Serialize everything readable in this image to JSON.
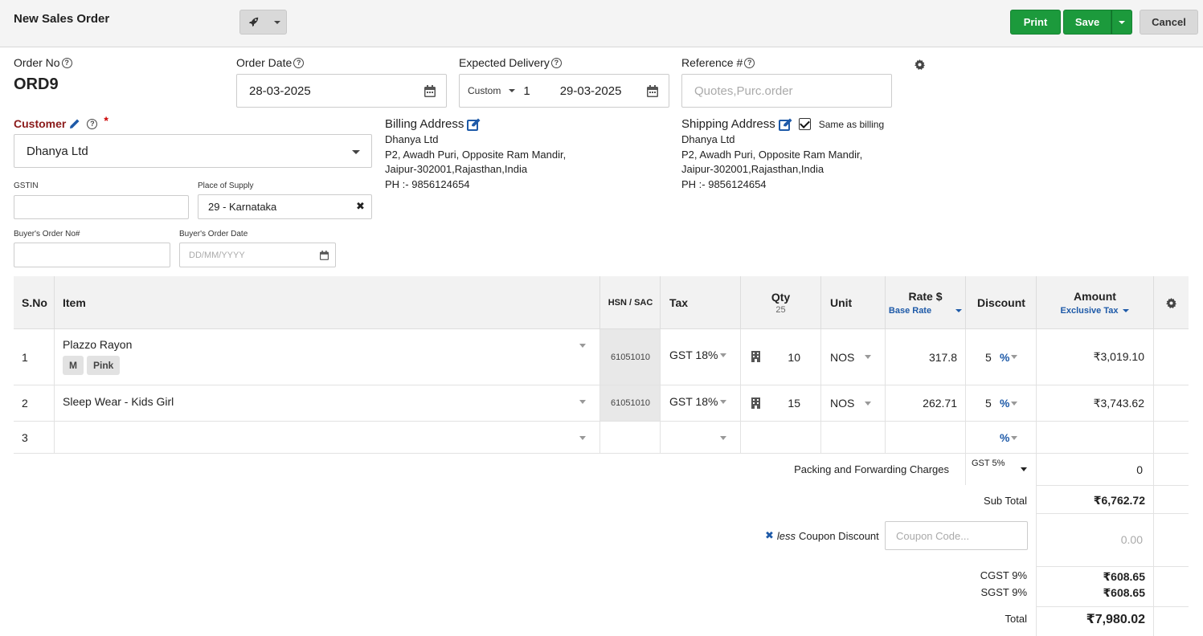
{
  "header": {
    "title": "New Sales Order",
    "print_label": "Print",
    "save_label": "Save",
    "cancel_label": "Cancel"
  },
  "order": {
    "order_no_label": "Order No",
    "order_no": "ORD9",
    "order_date_label": "Order Date",
    "order_date": "28-03-2025",
    "expected_delivery_label": "Expected Delivery",
    "delivery_mode": "Custom",
    "delivery_days": "1",
    "delivery_date": "29-03-2025",
    "reference_label": "Reference #",
    "reference_placeholder": "Quotes,Purc.order"
  },
  "customer": {
    "label": "Customer",
    "required_mark": "*",
    "value": "Dhanya Ltd",
    "gstin_label": "GSTIN",
    "gstin_value": "",
    "place_of_supply_label": "Place of Supply",
    "place_of_supply": "29 - Karnataka",
    "buyers_order_no_label": "Buyer's Order No#",
    "buyers_order_date_label": "Buyer's Order Date",
    "buyers_order_date_placeholder": "DD/MM/YYYY"
  },
  "billing": {
    "title": "Billing Address",
    "name": "Dhanya Ltd",
    "line1": "P2, Awadh Puri, Opposite Ram Mandir,",
    "line2": "Jaipur-302001,Rajasthan,India",
    "phone": "PH :- 9856124654"
  },
  "shipping": {
    "title": "Shipping Address",
    "same_as_billing_label": "Same as billing",
    "same_as_billing": true,
    "name": "Dhanya Ltd",
    "line1": "P2, Awadh Puri, Opposite Ram Mandir,",
    "line2": "Jaipur-302001,Rajasthan,India",
    "phone": "PH :- 9856124654"
  },
  "table": {
    "headers": {
      "sno": "S.No",
      "item": "Item",
      "hsn": "HSN / SAC",
      "tax": "Tax",
      "qty": "Qty",
      "qty_total": "25",
      "unit": "Unit",
      "rate": "Rate $",
      "rate_sub": "Base Rate",
      "discount": "Discount",
      "amount": "Amount",
      "amount_sub": "Exclusive Tax"
    },
    "rows": [
      {
        "sno": "1",
        "item": "Plazzo Rayon",
        "tags": [
          "M",
          "Pink"
        ],
        "hsn": "61051010",
        "tax": "GST 18%",
        "qty": "10",
        "unit": "NOS",
        "rate": "317.8",
        "discount": "5",
        "discount_type": "%",
        "amount": "₹3,019.10"
      },
      {
        "sno": "2",
        "item": "Sleep Wear - Kids Girl",
        "tags": [],
        "hsn": "61051010",
        "tax": "GST 18%",
        "qty": "15",
        "unit": "NOS",
        "rate": "262.71",
        "discount": "5",
        "discount_type": "%",
        "amount": "₹3,743.62"
      },
      {
        "sno": "3",
        "item": "",
        "tags": [],
        "hsn": "",
        "tax": "",
        "qty": "",
        "unit": "",
        "rate": "",
        "discount": "",
        "discount_type": "%",
        "amount": ""
      }
    ]
  },
  "summary": {
    "packing_label": "Packing and Forwarding Charges",
    "packing_tax": "GST 5%",
    "packing_value": "0",
    "subtotal_label": "Sub Total",
    "subtotal": "₹6,762.72",
    "less_label": "less",
    "coupon_label": "Coupon Discount",
    "coupon_placeholder": "Coupon Code...",
    "coupon_value": "0.00",
    "cgst_label": "CGST 9%",
    "cgst": "₹608.65",
    "sgst_label": "SGST 9%",
    "sgst": "₹608.65",
    "total_label": "Total",
    "total": "₹7,980.02"
  },
  "colors": {
    "green": "#1c9a3c",
    "blue": "#1e5aa8",
    "customer_label": "#8b1a1a"
  }
}
